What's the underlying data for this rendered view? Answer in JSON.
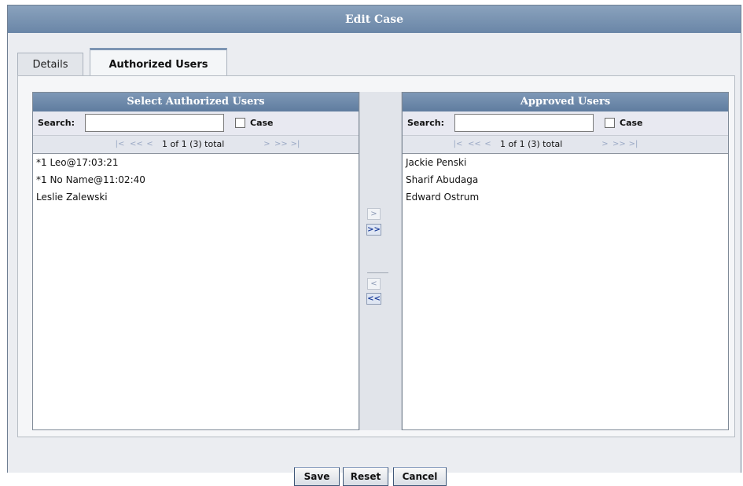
{
  "window": {
    "title": "Edit Case"
  },
  "tabs": [
    {
      "label": "Details",
      "active": false
    },
    {
      "label": "Authorized Users",
      "active": true
    }
  ],
  "left_panel": {
    "title": "Select Authorized Users",
    "search_label": "Search:",
    "search_value": "",
    "case_label": "Case",
    "case_checked": false,
    "pager_text": "1 of 1 (3) total",
    "items": [
      "*1 Leo@17:03:21",
      "*1 No Name@11:02:40",
      "Leslie Zalewski"
    ]
  },
  "right_panel": {
    "title": "Approved Users",
    "search_label": "Search:",
    "search_value": "",
    "case_label": "Case",
    "case_checked": false,
    "pager_text": "1 of 1 (3) total",
    "items": [
      "Jackie Penski",
      "Sharif Abudaga",
      "Edward Ostrum"
    ]
  },
  "transfer": {
    "move_right": ">",
    "move_all_right": ">>",
    "move_left": "<",
    "move_all_left": "<<"
  },
  "pager_icons": {
    "first": "|<",
    "prev_page": "<<",
    "prev": "<",
    "next": ">",
    "next_page": ">>",
    "last": ">|"
  },
  "footer": {
    "save_label": "Save",
    "reset_label": "Reset",
    "cancel_label": "Cancel"
  },
  "colors": {
    "header": "#6a86a7",
    "accent_blue": "#1d3f9a",
    "panel_bg": "#e8e9f1"
  }
}
